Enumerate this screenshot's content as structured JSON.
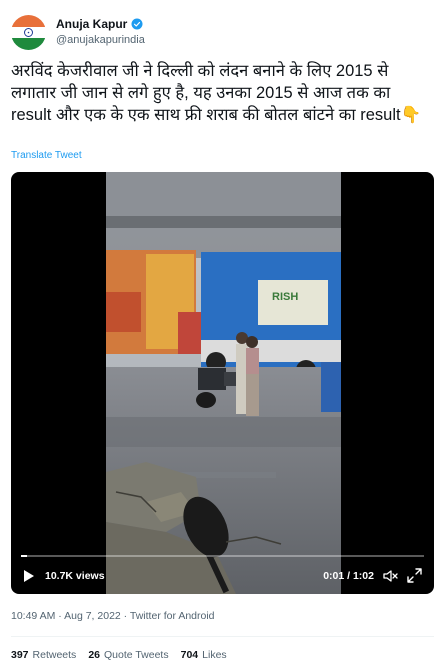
{
  "author": {
    "name": "Anuja Kapur",
    "handle": "@anujakapurindia",
    "verified_icon": "verified-badge-icon",
    "avatar": "indian-flag-avatar"
  },
  "tweet": {
    "text": "अरविंद केजरीवाल जी ने दिल्ली को लंदन बनाने के लिए 2015 से लगातार जी जान से लगे हुए है, यह उनका 2015 से आज तक का result और एक के एक साथ फ्री शराब की बोतल बांटने का result👇",
    "translate_label": "Translate Tweet"
  },
  "video": {
    "views": "10.7K views",
    "time": "0:01 / 1:02",
    "progress": 0.016,
    "play_icon": "play-icon",
    "mute_icon": "mute-icon",
    "fullscreen_icon": "fullscreen-icon",
    "truck_label": "RISH"
  },
  "meta": {
    "timestamp": "10:49 AM · Aug 7, 2022 · Twitter for Android"
  },
  "stats": {
    "retweets_count": "397",
    "retweets_label": "Retweets",
    "quotes_count": "26",
    "quotes_label": "Quote Tweets",
    "likes_count": "704",
    "likes_label": "Likes"
  },
  "colors": {
    "link": "#1d9bf0",
    "secondary_text": "#536471",
    "primary_text": "#0f1419"
  }
}
